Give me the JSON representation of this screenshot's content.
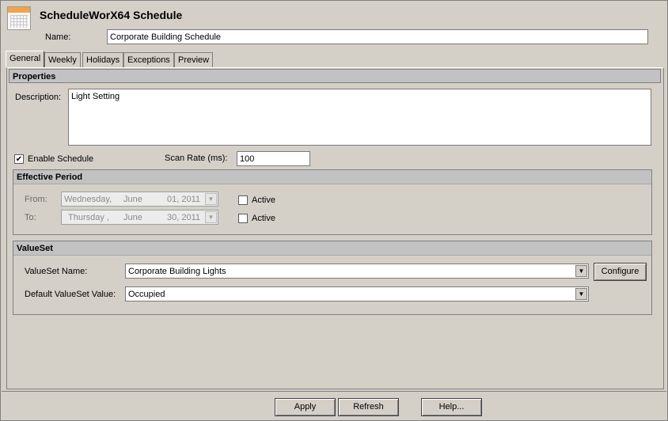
{
  "header": {
    "title": "ScheduleWorX64 Schedule",
    "name_label": "Name:",
    "name_value": "Corporate Building Schedule"
  },
  "tabs": [
    {
      "label": "General",
      "active": true
    },
    {
      "label": "Weekly",
      "active": false
    },
    {
      "label": "Holidays",
      "active": false
    },
    {
      "label": "Exceptions",
      "active": false
    },
    {
      "label": "Preview",
      "active": false
    }
  ],
  "properties": {
    "title": "Properties",
    "description_label": "Description:",
    "description_value": "Light Setting",
    "enable_label": "Enable Schedule",
    "enable_checked": true,
    "scan_rate_label": "Scan Rate (ms):",
    "scan_rate_value": "100"
  },
  "effective_period": {
    "title": "Effective Period",
    "from_label": "From:",
    "from": {
      "weekday": "Wednesday,",
      "month": "June",
      "day_year": "01, 2011"
    },
    "from_active_label": "Active",
    "to_label": "To:",
    "to": {
      "weekday": "Thursday  ,",
      "month": "June",
      "day_year": "30, 2011"
    },
    "to_active_label": "Active"
  },
  "valueset": {
    "title": "ValueSet",
    "name_label": "ValueSet Name:",
    "name_value": "Corporate Building Lights",
    "configure_label": "Configure",
    "default_label": "Default ValueSet Value:",
    "default_value": "Occupied"
  },
  "footer": {
    "apply": "Apply",
    "refresh": "Refresh",
    "help": "Help..."
  }
}
